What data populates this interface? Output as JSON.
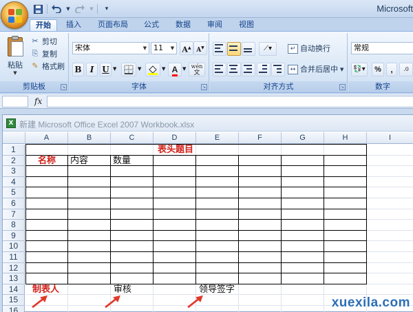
{
  "window": {
    "title": "Microsoft"
  },
  "quick_access": {
    "icons": [
      "save-icon",
      "undo-icon",
      "redo-icon",
      "customize-icon"
    ]
  },
  "tabs": [
    "开始",
    "插入",
    "页面布局",
    "公式",
    "数据",
    "审阅",
    "视图"
  ],
  "active_tab": "开始",
  "ribbon": {
    "clipboard": {
      "label": "剪贴板",
      "paste": "粘贴",
      "cut": "剪切",
      "copy": "复制",
      "format_painter": "格式刷"
    },
    "font": {
      "label": "字体",
      "font_name": "宋体",
      "font_size": "11",
      "bold": "B",
      "italic": "I",
      "underline": "U",
      "phonetic": "wén"
    },
    "alignment": {
      "label": "对齐方式",
      "wrap_text": "自动换行",
      "merge_center": "合并后居中"
    },
    "number": {
      "label": "数字",
      "format": "常规",
      "percent": "%",
      "comma": ","
    }
  },
  "formula_bar": {
    "fx": "fx",
    "name_box": "",
    "content": ""
  },
  "workbook": {
    "title": "新建 Microsoft Office Excel 2007 Workbook.xlsx",
    "columns": [
      "A",
      "B",
      "C",
      "D",
      "E",
      "F",
      "G",
      "H",
      "I"
    ],
    "rows": [
      "1",
      "2",
      "3",
      "4",
      "5",
      "6",
      "7",
      "8",
      "9",
      "10",
      "11",
      "12",
      "13",
      "14",
      "15",
      "16"
    ],
    "cells": {
      "d1": "表头题目",
      "a2": "名称",
      "b2": "内容",
      "c2": "数量",
      "a14": "制表人",
      "c14": "审核",
      "e14": "领导签字"
    }
  },
  "colors": {
    "accent_red": "#d0221b",
    "arrow_red": "#e03a2a",
    "ribbon_text": "#15428b"
  },
  "watermark": "xuexila.com"
}
